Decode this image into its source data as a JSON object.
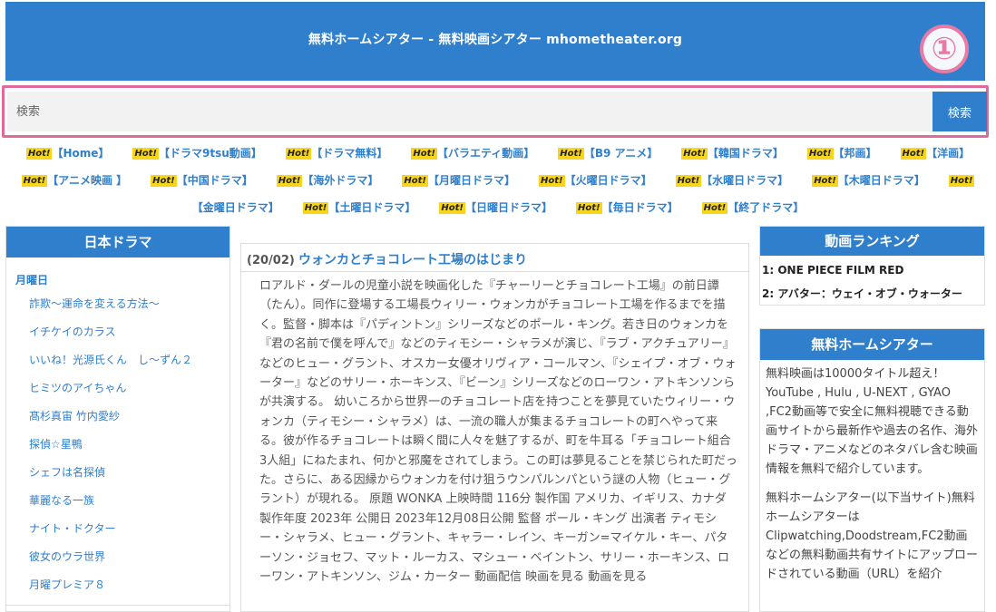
{
  "header": {
    "title": "無料ホームシアター - 無料映画シアター mhometheater.org",
    "marker": "①"
  },
  "search": {
    "placeholder": "検索",
    "button": "検索"
  },
  "nav": {
    "hot_badge": "Hot!",
    "row1": [
      "【Home】",
      "【ドラマ9tsu動画】",
      "【ドラマ無料】",
      "【バラエティ動画】",
      "【B9 アニメ】",
      "【韓国ドラマ】",
      "【邦画】",
      "【洋画】"
    ],
    "row2": [
      "【アニメ映画 】",
      "【中国ドラマ】",
      "【海外ドラマ】",
      "【月曜日ドラマ】",
      "【火曜日ドラマ】",
      "【水曜日ドラマ】",
      "【木曜日ドラマ】"
    ],
    "row3": [
      "【金曜日ドラマ】",
      "【土曜日ドラマ】",
      "【日曜日ドラマ】",
      "【毎日ドラマ】",
      "【終了ドラマ】"
    ]
  },
  "left": {
    "title": "日本ドラマ",
    "day": "月曜日",
    "items": [
      "詐欺〜運命を変える方法〜",
      "イチケイのカラス",
      "いいね！光源氏くん　し〜ずん２",
      "ヒミツのアイちゃん",
      "髙杉真宙 竹内愛紗",
      "探偵☆星鴨",
      "シェフは名探偵",
      "華麗なる一族",
      "ナイト・ドクター",
      "彼女のウラ世界",
      "月曜プレミア８"
    ]
  },
  "post": {
    "date": "(20/02)",
    "title": "ウォンカとチョコレート工場のはじまり",
    "body": "ロアルド・ダールの児童小説を映画化した『チャーリーとチョコレート工場』の前日譚（たん）。同作に登場する工場長ウィリー・ウォンカがチョコレート工場を作るまでを描く。監督・脚本は『パディントン』シリーズなどのポール・キング。若き日のウォンカを『君の名前で僕を呼んで』などのティモシー・シャラメが演じ、『ラブ・アクチュアリー』などのヒュー・グラント、オスカー女優オリヴィア・コールマン、『シェイプ・オブ・ウォーター』などのサリー・ホーキンス、『ビーン』シリーズなどのローワン・アトキンソンらが共演する。 幼いころから世界一のチョコレート店を持つことを夢見ていたウィリー・ウォンカ（ティモシー・シャラメ）は、一流の職人が集まるチョコレートの町へやって来る。彼が作るチョコレートは瞬く間に人々を魅了するが、町を牛耳る「チョコレート組合3人組」にねたまれ、何かと邪魔をされてしまう。この町は夢見ることを禁じられた町だった。さらに、ある因縁からウォンカを付け狙うウンパルンパという謎の人物（ヒュー・グラント）が現れる。 原題 WONKA 上映時間 116分 製作国 アメリカ、イギリス、カナダ 製作年度 2023年 公開日 2023年12月08日公開 監督 ポール・キング 出演者 ティモシー・シャラメ、ヒュー・グラント、キャラー・レイン、キーガン=マイケル・キー、パターソン・ジョセフ、マット・ルーカス、マシュー・ベイントン、サリー・ホーキンス、ローワン・アトキンソン、ジム・カーター 動画配信 映画を見る 動画を見る"
  },
  "ranking": {
    "title": "動画ランキング",
    "items": [
      "1: ONE PIECE FILM RED",
      "2: アバター：ウェイ・オブ・ウォーター"
    ]
  },
  "about": {
    "title": "無料ホームシアター",
    "p1": "無料映画は10000タイトル超え！YouTube , Hulu , U-NEXT , GYAO ,FC2動画等で安全に無料視聴できる動画サイトから最新作や過去の名作、海外ドラマ・アニメなどのネタバレ含む映画情報を無料で紹介しています。",
    "p2": "無料ホームシアター(以下当サイト)無料ホームシアターはClipwatching,Doodstream,FC2動画などの無料動画共有サイトにアップロードされている動画（URL）を紹介"
  }
}
